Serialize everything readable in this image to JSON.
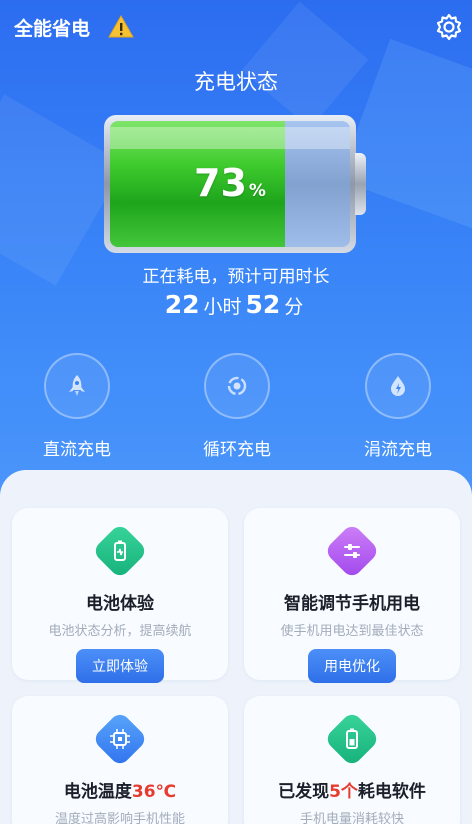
{
  "header": {
    "app_title": "全能省电"
  },
  "status": {
    "title": "充电状态",
    "battery_percent": 73,
    "percent_value": "73",
    "percent_unit": "%",
    "drain_text": "正在耗电，预计可用时长",
    "hours": "22",
    "hours_unit": "小时",
    "minutes": "52",
    "minutes_unit": "分"
  },
  "modes": [
    {
      "label": "直流充电",
      "icon": "rocket-icon"
    },
    {
      "label": "循环充电",
      "icon": "cycle-icon"
    },
    {
      "label": "涓流充电",
      "icon": "water-drop-icon"
    }
  ],
  "cards": [
    {
      "title": "电池体验",
      "desc": "电池状态分析，提高续航",
      "button": "立即体验",
      "icon": "battery-icon",
      "color": "#22c08a"
    },
    {
      "title": "智能调节手机用电",
      "desc": "使手机用电达到最佳状态",
      "button": "用电优化",
      "icon": "sliders-icon",
      "color": "#b45cf0"
    },
    {
      "title_prefix": "电池温度",
      "title_highlight": "36℃",
      "desc": "温度过高影响手机性能",
      "icon": "chip-icon",
      "color": "#3a8ef6"
    },
    {
      "title_prefix": "已发现",
      "title_highlight": "5个",
      "title_suffix": "耗电软件",
      "desc": "手机电量消耗较快",
      "icon": "battery-icon",
      "color": "#22c08a"
    }
  ],
  "colors": {
    "accent": "#2f74f2",
    "highlight": "#e63b2e",
    "battery_green": "#3ecb2d"
  }
}
